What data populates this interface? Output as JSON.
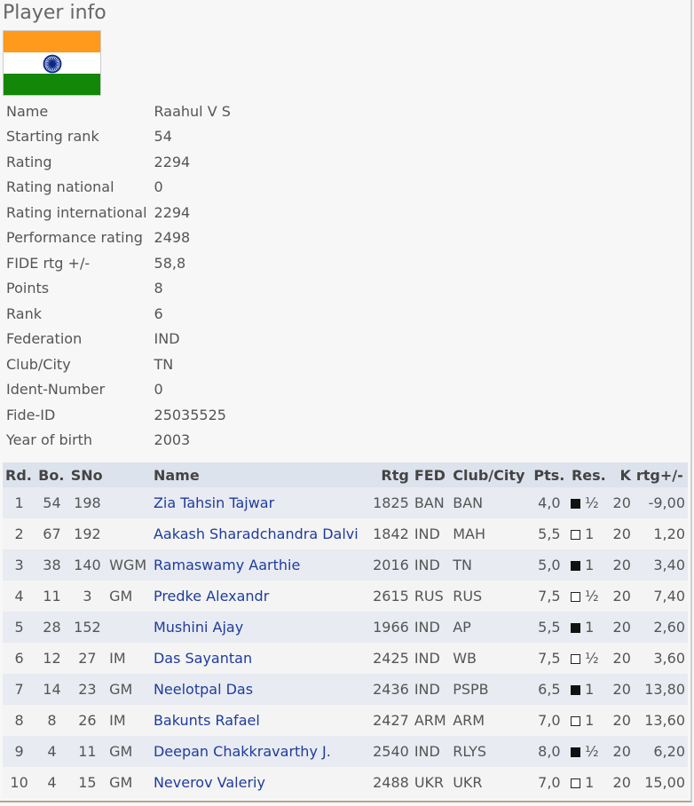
{
  "page_title": "Player info",
  "flag": {
    "top": "#ff9a1c",
    "middle": "#ffffff",
    "bottom": "#138808",
    "wheel": "#0a2a8a"
  },
  "info": [
    {
      "label": "Name",
      "value": "Raahul V S"
    },
    {
      "label": "Starting rank",
      "value": "54"
    },
    {
      "label": "Rating",
      "value": "2294"
    },
    {
      "label": "Rating national",
      "value": "0"
    },
    {
      "label": "Rating international",
      "value": "2294"
    },
    {
      "label": "Performance rating",
      "value": "2498"
    },
    {
      "label": "FIDE rtg +/-",
      "value": "58,8"
    },
    {
      "label": "Points",
      "value": "8"
    },
    {
      "label": "Rank",
      "value": "6"
    },
    {
      "label": "Federation",
      "value": "IND"
    },
    {
      "label": "Club/City",
      "value": "TN"
    },
    {
      "label": "Ident-Number",
      "value": "0"
    },
    {
      "label": "Fide-ID",
      "value": "25035525"
    },
    {
      "label": "Year of birth",
      "value": "2003"
    }
  ],
  "games": {
    "headers": [
      "Rd.",
      "Bo.",
      "SNo",
      "",
      "Name",
      "Rtg",
      "FED",
      "Club/City",
      "Pts.",
      "Res.",
      "K",
      "rtg+/-"
    ],
    "rows": [
      {
        "rd": "1",
        "bo": "54",
        "sno": "198",
        "title": "",
        "name": "Zia Tahsin Tajwar",
        "rtg": "1825",
        "fed": "BAN",
        "club": "BAN",
        "pts": "4,0",
        "color": "black",
        "res": "½",
        "k": "20",
        "delta": "-9,00"
      },
      {
        "rd": "2",
        "bo": "67",
        "sno": "192",
        "title": "",
        "name": "Aakash Sharadchandra Dalvi",
        "rtg": "1842",
        "fed": "IND",
        "club": "MAH",
        "pts": "5,5",
        "color": "white",
        "res": "1",
        "k": "20",
        "delta": "1,20"
      },
      {
        "rd": "3",
        "bo": "38",
        "sno": "140",
        "title": "WGM",
        "name": "Ramaswamy Aarthie",
        "rtg": "2016",
        "fed": "IND",
        "club": "TN",
        "pts": "5,0",
        "color": "black",
        "res": "1",
        "k": "20",
        "delta": "3,40"
      },
      {
        "rd": "4",
        "bo": "11",
        "sno": "3",
        "title": "GM",
        "name": "Predke Alexandr",
        "rtg": "2615",
        "fed": "RUS",
        "club": "RUS",
        "pts": "7,5",
        "color": "white",
        "res": "½",
        "k": "20",
        "delta": "7,40"
      },
      {
        "rd": "5",
        "bo": "28",
        "sno": "152",
        "title": "",
        "name": "Mushini Ajay",
        "rtg": "1966",
        "fed": "IND",
        "club": "AP",
        "pts": "5,5",
        "color": "black",
        "res": "1",
        "k": "20",
        "delta": "2,60"
      },
      {
        "rd": "6",
        "bo": "12",
        "sno": "27",
        "title": "IM",
        "name": "Das Sayantan",
        "rtg": "2425",
        "fed": "IND",
        "club": "WB",
        "pts": "7,5",
        "color": "white",
        "res": "½",
        "k": "20",
        "delta": "3,60"
      },
      {
        "rd": "7",
        "bo": "14",
        "sno": "23",
        "title": "GM",
        "name": "Neelotpal Das",
        "rtg": "2436",
        "fed": "IND",
        "club": "PSPB",
        "pts": "6,5",
        "color": "black",
        "res": "1",
        "k": "20",
        "delta": "13,80"
      },
      {
        "rd": "8",
        "bo": "8",
        "sno": "26",
        "title": "IM",
        "name": "Bakunts Rafael",
        "rtg": "2427",
        "fed": "ARM",
        "club": "ARM",
        "pts": "7,0",
        "color": "white",
        "res": "1",
        "k": "20",
        "delta": "13,60"
      },
      {
        "rd": "9",
        "bo": "4",
        "sno": "11",
        "title": "GM",
        "name": "Deepan Chakkravarthy J.",
        "rtg": "2540",
        "fed": "IND",
        "club": "RLYS",
        "pts": "8,0",
        "color": "black",
        "res": "½",
        "k": "20",
        "delta": "6,20"
      },
      {
        "rd": "10",
        "bo": "4",
        "sno": "15",
        "title": "GM",
        "name": "Neverov Valeriy",
        "rtg": "2488",
        "fed": "UKR",
        "club": "UKR",
        "pts": "7,0",
        "color": "white",
        "res": "1",
        "k": "20",
        "delta": "15,00"
      }
    ]
  }
}
